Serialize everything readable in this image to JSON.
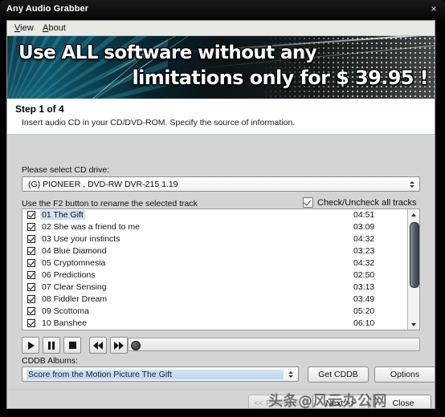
{
  "window": {
    "title": "Any Audio Grabber",
    "close_label": "×"
  },
  "menubar": {
    "items": [
      {
        "label": "View",
        "accel": "V",
        "rest": "iew"
      },
      {
        "label": "About",
        "accel": "A",
        "rest": "bout"
      }
    ]
  },
  "banner": {
    "line1": "Use ALL software without any",
    "line2": "limitations only for $ 39.95 !"
  },
  "step": {
    "title": "Step 1 of 4",
    "description": "Insert audio CD in your CD/DVD-ROM. Specify the source of information."
  },
  "drive": {
    "label": "Please select CD drive:",
    "value": "(G) PIONEER , DVD-RW  DVR-215   1.19"
  },
  "tracks": {
    "hint": "Use the F2 button to rename the selected track",
    "check_all_label": "Check/Uncheck all tracks",
    "check_all_checked": true,
    "items": [
      {
        "name": "01 The Gift",
        "duration": "04:51",
        "checked": true,
        "selected": true
      },
      {
        "name": "02 She was a friend to me",
        "duration": "03:09",
        "checked": true,
        "selected": false
      },
      {
        "name": "03 Use your instincts",
        "duration": "04:32",
        "checked": true,
        "selected": false
      },
      {
        "name": "04 Blue Diamond",
        "duration": "03:23",
        "checked": true,
        "selected": false
      },
      {
        "name": "05 Cryptomnesia",
        "duration": "04:32",
        "checked": true,
        "selected": false
      },
      {
        "name": "06 Predictions",
        "duration": "02:50",
        "checked": true,
        "selected": false
      },
      {
        "name": "07 Clear Sensing",
        "duration": "03:13",
        "checked": true,
        "selected": false
      },
      {
        "name": "08 Fiddler Dream",
        "duration": "03:49",
        "checked": true,
        "selected": false
      },
      {
        "name": "09 Scottoma",
        "duration": "05:20",
        "checked": true,
        "selected": false
      },
      {
        "name": "10 Banshee",
        "duration": "06:10",
        "checked": true,
        "selected": false
      }
    ]
  },
  "transport": {
    "play": "play-icon",
    "pause": "pause-icon",
    "stop": "stop-icon",
    "previous_track": "rewind-icon",
    "next_track": "fast-forward-icon",
    "seek_position_percent": 0
  },
  "cddb": {
    "label": "CDDB Albums:",
    "album_value": "Score from the Motion Picture The Gift",
    "get_button": "Get CDDB",
    "options_button": "Options"
  },
  "footer": {
    "previous": "<< Previous",
    "next": "Next >>",
    "close": "Close",
    "previous_enabled": false
  },
  "watermark": {
    "text": "头条@风云办公网"
  }
}
